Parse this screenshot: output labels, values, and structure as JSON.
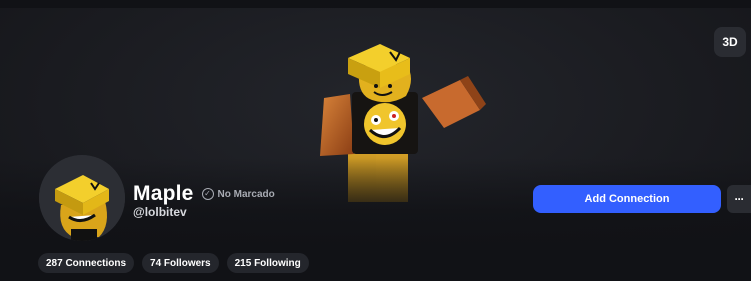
{
  "header": {
    "view_toggle_label": "3D"
  },
  "profile": {
    "display_name": "Maple",
    "verification_label": "No Marcado",
    "username": "@lolbitev"
  },
  "actions": {
    "add_connection_label": "Add Connection",
    "more_label": "···"
  },
  "stats": [
    {
      "label": "287 Connections"
    },
    {
      "label": "74 Followers"
    },
    {
      "label": "215 Following"
    }
  ],
  "colors": {
    "primary_button": "#335fff",
    "background": "#111216",
    "pill": "#24262c"
  }
}
